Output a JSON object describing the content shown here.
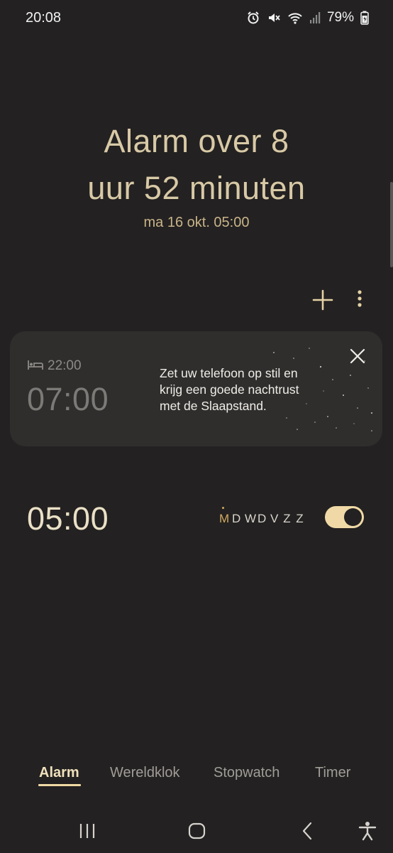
{
  "status_bar": {
    "time": "20:08",
    "battery_percent": "79%",
    "icons": [
      "alarm-icon",
      "mute-icon",
      "wifi-icon",
      "signal-icon",
      "battery-icon"
    ]
  },
  "hero": {
    "line1": "Alarm over 8",
    "line2": "uur 52 minuten",
    "date": "ma 16 okt. 05:00"
  },
  "toolbar": {
    "add_icon": "plus-icon",
    "more_icon": "more-vertical-icon"
  },
  "sleep_card": {
    "bedtime": "22:00",
    "wake_time": "07:00",
    "message_line1": "Zet uw telefoon op stil en",
    "message_line2": "krijg een goede nachtrust",
    "message_line3": "met de Slaapstand."
  },
  "alarm": {
    "time": "05:00",
    "days": [
      "M",
      "D",
      "W",
      "D",
      "V",
      "Z",
      "Z"
    ],
    "active_day_index": 0,
    "enabled": true
  },
  "tabs": [
    "Alarm",
    "Wereldklok",
    "Stopwatch",
    "Timer"
  ],
  "active_tab": "Alarm",
  "colors": {
    "background": "#232121",
    "accent": "#d8c9a6",
    "toggle_on": "#f0d9a6",
    "card": "#2f2e2d"
  }
}
